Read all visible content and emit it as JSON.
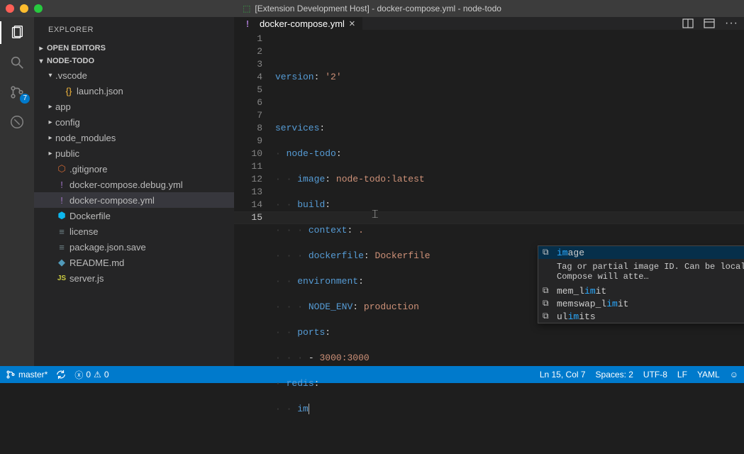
{
  "titlebar": {
    "text": "[Extension Development Host] - docker-compose.yml - node-todo"
  },
  "explorer": {
    "title": "EXPLORER"
  },
  "sections": {
    "openEditors": {
      "label": "OPEN EDITORS",
      "expanded": false
    },
    "project": {
      "label": "NODE-TODO",
      "expanded": true
    }
  },
  "tree": {
    "vscode": {
      "label": ".vscode"
    },
    "launch": {
      "label": "launch.json"
    },
    "app": {
      "label": "app"
    },
    "config": {
      "label": "config"
    },
    "node_modules": {
      "label": "node_modules"
    },
    "public": {
      "label": "public"
    },
    "gitignore": {
      "label": ".gitignore"
    },
    "dcDebug": {
      "label": "docker-compose.debug.yml"
    },
    "dc": {
      "label": "docker-compose.yml"
    },
    "dockerfile": {
      "label": "Dockerfile"
    },
    "license": {
      "label": "license"
    },
    "pkg": {
      "label": "package.json.save"
    },
    "readme": {
      "label": "README.md"
    },
    "server": {
      "label": "server.js"
    }
  },
  "tab": {
    "label": "docker-compose.yml"
  },
  "scm_badge": "7",
  "suggest": {
    "items": [
      {
        "label_pre": "",
        "match": "im",
        "label_post": "age"
      },
      {
        "label_pre": "mem_l",
        "match": "im",
        "label_post": "it"
      },
      {
        "label_pre": "memswap_l",
        "match": "im",
        "label_post": "it"
      },
      {
        "label_pre": "ul",
        "match": "im",
        "label_post": "its"
      }
    ],
    "doc": "Tag or partial image ID. Can be local or remote - Compose will atte…"
  },
  "statusbar": {
    "branch": "master*",
    "errors": "0",
    "warnings": "0",
    "lncol": "Ln 15, Col 7",
    "spaces": "Spaces: 2",
    "encoding": "UTF-8",
    "eol": "LF",
    "lang": "YAML"
  },
  "lines": [
    "1",
    "2",
    "3",
    "4",
    "5",
    "6",
    "7",
    "8",
    "9",
    "10",
    "11",
    "12",
    "13",
    "14",
    "15"
  ]
}
